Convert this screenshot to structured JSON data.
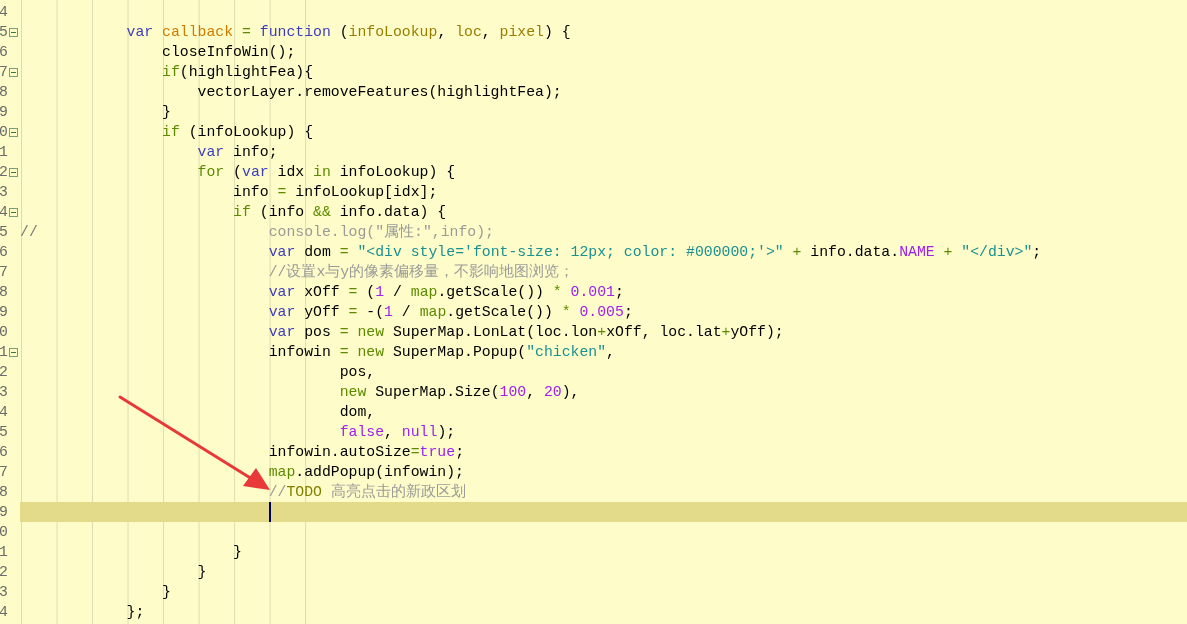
{
  "editor": {
    "lines": [
      {
        "number": "4",
        "fold": false,
        "current": false
      },
      {
        "number": "5",
        "fold": true,
        "current": false,
        "tokens": [
          {
            "text": "            var",
            "kind": "keyword"
          },
          {
            "text": " callback",
            "kind": "def"
          },
          {
            "text": " =",
            "kind": "operator"
          },
          {
            "text": " function",
            "kind": "keyword"
          },
          {
            "text": " (",
            "kind": "plain"
          },
          {
            "text": "infoLookup",
            "kind": "param"
          },
          {
            "text": ", ",
            "kind": "plain"
          },
          {
            "text": "loc",
            "kind": "param"
          },
          {
            "text": ", ",
            "kind": "plain"
          },
          {
            "text": "pixel",
            "kind": "param"
          },
          {
            "text": ") {",
            "kind": "plain"
          }
        ]
      },
      {
        "number": "6",
        "fold": false,
        "current": false,
        "tokens": [
          {
            "text": "                closeInfoWin();",
            "kind": "plain"
          }
        ]
      },
      {
        "number": "7",
        "fold": true,
        "current": false,
        "tokens": [
          {
            "text": "                if",
            "kind": "control"
          },
          {
            "text": "(highlightFea){",
            "kind": "plain"
          }
        ]
      },
      {
        "number": "8",
        "fold": false,
        "current": false,
        "tokens": [
          {
            "text": "                    vectorLayer.removeFeatures(highlightFea);",
            "kind": "plain"
          }
        ]
      },
      {
        "number": "9",
        "fold": false,
        "current": false,
        "tokens": [
          {
            "text": "                }",
            "kind": "plain"
          }
        ]
      },
      {
        "number": "0",
        "fold": true,
        "current": false,
        "tokens": [
          {
            "text": "                if",
            "kind": "control"
          },
          {
            "text": " (infoLookup) {",
            "kind": "plain"
          }
        ]
      },
      {
        "number": "1",
        "fold": false,
        "current": false,
        "tokens": [
          {
            "text": "                    var",
            "kind": "keyword"
          },
          {
            "text": " info;",
            "kind": "plain"
          }
        ]
      },
      {
        "number": "2",
        "fold": true,
        "current": false,
        "tokens": [
          {
            "text": "                    for",
            "kind": "control"
          },
          {
            "text": " (",
            "kind": "plain"
          },
          {
            "text": "var",
            "kind": "keyword"
          },
          {
            "text": " idx ",
            "kind": "plain"
          },
          {
            "text": "in",
            "kind": "control"
          },
          {
            "text": " infoLookup) {",
            "kind": "plain"
          }
        ]
      },
      {
        "number": "3",
        "fold": false,
        "current": false,
        "tokens": [
          {
            "text": "                        info ",
            "kind": "plain"
          },
          {
            "text": "=",
            "kind": "operator"
          },
          {
            "text": " infoLookup[idx];",
            "kind": "plain"
          }
        ]
      },
      {
        "number": "4",
        "fold": true,
        "current": false,
        "tokens": [
          {
            "text": "                        if",
            "kind": "control"
          },
          {
            "text": " (info ",
            "kind": "plain"
          },
          {
            "text": "&&",
            "kind": "operator"
          },
          {
            "text": " info.data) {",
            "kind": "plain"
          }
        ]
      },
      {
        "number": "5",
        "fold": false,
        "current": false,
        "tokens": [
          {
            "text": "//",
            "kind": "slashes"
          },
          {
            "text": "                          console.log(\"属性:\",info);",
            "kind": "comment"
          }
        ]
      },
      {
        "number": "6",
        "fold": false,
        "current": false,
        "tokens": [
          {
            "text": "                            var",
            "kind": "keyword"
          },
          {
            "text": " dom ",
            "kind": "plain"
          },
          {
            "text": "=",
            "kind": "operator"
          },
          {
            "text": " \"<div style='font-size: 12px; color: #000000;'>\"",
            "kind": "string"
          },
          {
            "text": " +",
            "kind": "operator"
          },
          {
            "text": " info.data.",
            "kind": "plain"
          },
          {
            "text": "NAME",
            "kind": "number"
          },
          {
            "text": " +",
            "kind": "operator"
          },
          {
            "text": " \"</div>\"",
            "kind": "string"
          },
          {
            "text": ";",
            "kind": "plain"
          }
        ]
      },
      {
        "number": "7",
        "fold": false,
        "current": false,
        "tokens": [
          {
            "text": "                            //设置x与y的像素偏移量，不影响地图浏览；",
            "kind": "comment"
          }
        ]
      },
      {
        "number": "8",
        "fold": false,
        "current": false,
        "tokens": [
          {
            "text": "                            var",
            "kind": "keyword"
          },
          {
            "text": " xOff ",
            "kind": "plain"
          },
          {
            "text": "=",
            "kind": "operator"
          },
          {
            "text": " (",
            "kind": "plain"
          },
          {
            "text": "1",
            "kind": "number"
          },
          {
            "text": " / ",
            "kind": "plain"
          },
          {
            "text": "map",
            "kind": "control"
          },
          {
            "text": ".getScale()) ",
            "kind": "plain"
          },
          {
            "text": "*",
            "kind": "operator"
          },
          {
            "text": " 0.001",
            "kind": "number"
          },
          {
            "text": ";",
            "kind": "plain"
          }
        ]
      },
      {
        "number": "9",
        "fold": false,
        "current": false,
        "tokens": [
          {
            "text": "                            var",
            "kind": "keyword"
          },
          {
            "text": " yOff ",
            "kind": "plain"
          },
          {
            "text": "=",
            "kind": "operator"
          },
          {
            "text": " -(",
            "kind": "plain"
          },
          {
            "text": "1",
            "kind": "number"
          },
          {
            "text": " / ",
            "kind": "plain"
          },
          {
            "text": "map",
            "kind": "control"
          },
          {
            "text": ".getScale()) ",
            "kind": "plain"
          },
          {
            "text": "*",
            "kind": "operator"
          },
          {
            "text": " 0.005",
            "kind": "number"
          },
          {
            "text": ";",
            "kind": "plain"
          }
        ]
      },
      {
        "number": "0",
        "fold": false,
        "current": false,
        "tokens": [
          {
            "text": "                            var",
            "kind": "keyword"
          },
          {
            "text": " pos ",
            "kind": "plain"
          },
          {
            "text": "=",
            "kind": "operator"
          },
          {
            "text": " new",
            "kind": "control"
          },
          {
            "text": " SuperMap.LonLat(loc.lon",
            "kind": "plain"
          },
          {
            "text": "+",
            "kind": "operator"
          },
          {
            "text": "xOff, loc.lat",
            "kind": "plain"
          },
          {
            "text": "+",
            "kind": "operator"
          },
          {
            "text": "yOff);",
            "kind": "plain"
          }
        ]
      },
      {
        "number": "1",
        "fold": true,
        "current": false,
        "tokens": [
          {
            "text": "                            infowin ",
            "kind": "plain"
          },
          {
            "text": "=",
            "kind": "operator"
          },
          {
            "text": " new",
            "kind": "control"
          },
          {
            "text": " SuperMap.Popup(",
            "kind": "plain"
          },
          {
            "text": "\"chicken\"",
            "kind": "string"
          },
          {
            "text": ",",
            "kind": "plain"
          }
        ]
      },
      {
        "number": "2",
        "fold": false,
        "current": false,
        "tokens": [
          {
            "text": "                                    pos,",
            "kind": "plain"
          }
        ]
      },
      {
        "number": "3",
        "fold": false,
        "current": false,
        "tokens": [
          {
            "text": "                                    new",
            "kind": "control"
          },
          {
            "text": " SuperMap.Size(",
            "kind": "plain"
          },
          {
            "text": "100",
            "kind": "number"
          },
          {
            "text": ", ",
            "kind": "plain"
          },
          {
            "text": "20",
            "kind": "number"
          },
          {
            "text": "),",
            "kind": "plain"
          }
        ]
      },
      {
        "number": "4",
        "fold": false,
        "current": false,
        "tokens": [
          {
            "text": "                                    dom,",
            "kind": "plain"
          }
        ]
      },
      {
        "number": "5",
        "fold": false,
        "current": false,
        "tokens": [
          {
            "text": "                                    false",
            "kind": "number"
          },
          {
            "text": ", ",
            "kind": "plain"
          },
          {
            "text": "null",
            "kind": "number"
          },
          {
            "text": ");",
            "kind": "plain"
          }
        ]
      },
      {
        "number": "6",
        "fold": false,
        "current": false,
        "tokens": [
          {
            "text": "                            infowin.autoSize",
            "kind": "plain"
          },
          {
            "text": "=",
            "kind": "operator"
          },
          {
            "text": "true",
            "kind": "number"
          },
          {
            "text": ";",
            "kind": "plain"
          }
        ]
      },
      {
        "number": "7",
        "fold": false,
        "current": false,
        "tokens": [
          {
            "text": "                            map",
            "kind": "control"
          },
          {
            "text": ".addPopup(infowin);",
            "kind": "plain"
          }
        ]
      },
      {
        "number": "8",
        "fold": false,
        "current": false,
        "tokens": [
          {
            "text": "                            //",
            "kind": "comment"
          },
          {
            "text": "TODO",
            "kind": "todo"
          },
          {
            "text": " 高亮点击的新政区划",
            "kind": "comment"
          }
        ]
      },
      {
        "number": "9",
        "fold": false,
        "current": true
      },
      {
        "number": "0",
        "fold": false,
        "current": false
      },
      {
        "number": "1",
        "fold": false,
        "current": false,
        "tokens": [
          {
            "text": "                        }",
            "kind": "plain"
          }
        ]
      },
      {
        "number": "2",
        "fold": false,
        "current": false,
        "tokens": [
          {
            "text": "                    }",
            "kind": "plain"
          }
        ]
      },
      {
        "number": "3",
        "fold": false,
        "current": false,
        "tokens": [
          {
            "text": "                }",
            "kind": "plain"
          }
        ]
      },
      {
        "number": "4",
        "fold": false,
        "current": false,
        "tokens": [
          {
            "text": "            };",
            "kind": "plain"
          }
        ]
      }
    ]
  }
}
